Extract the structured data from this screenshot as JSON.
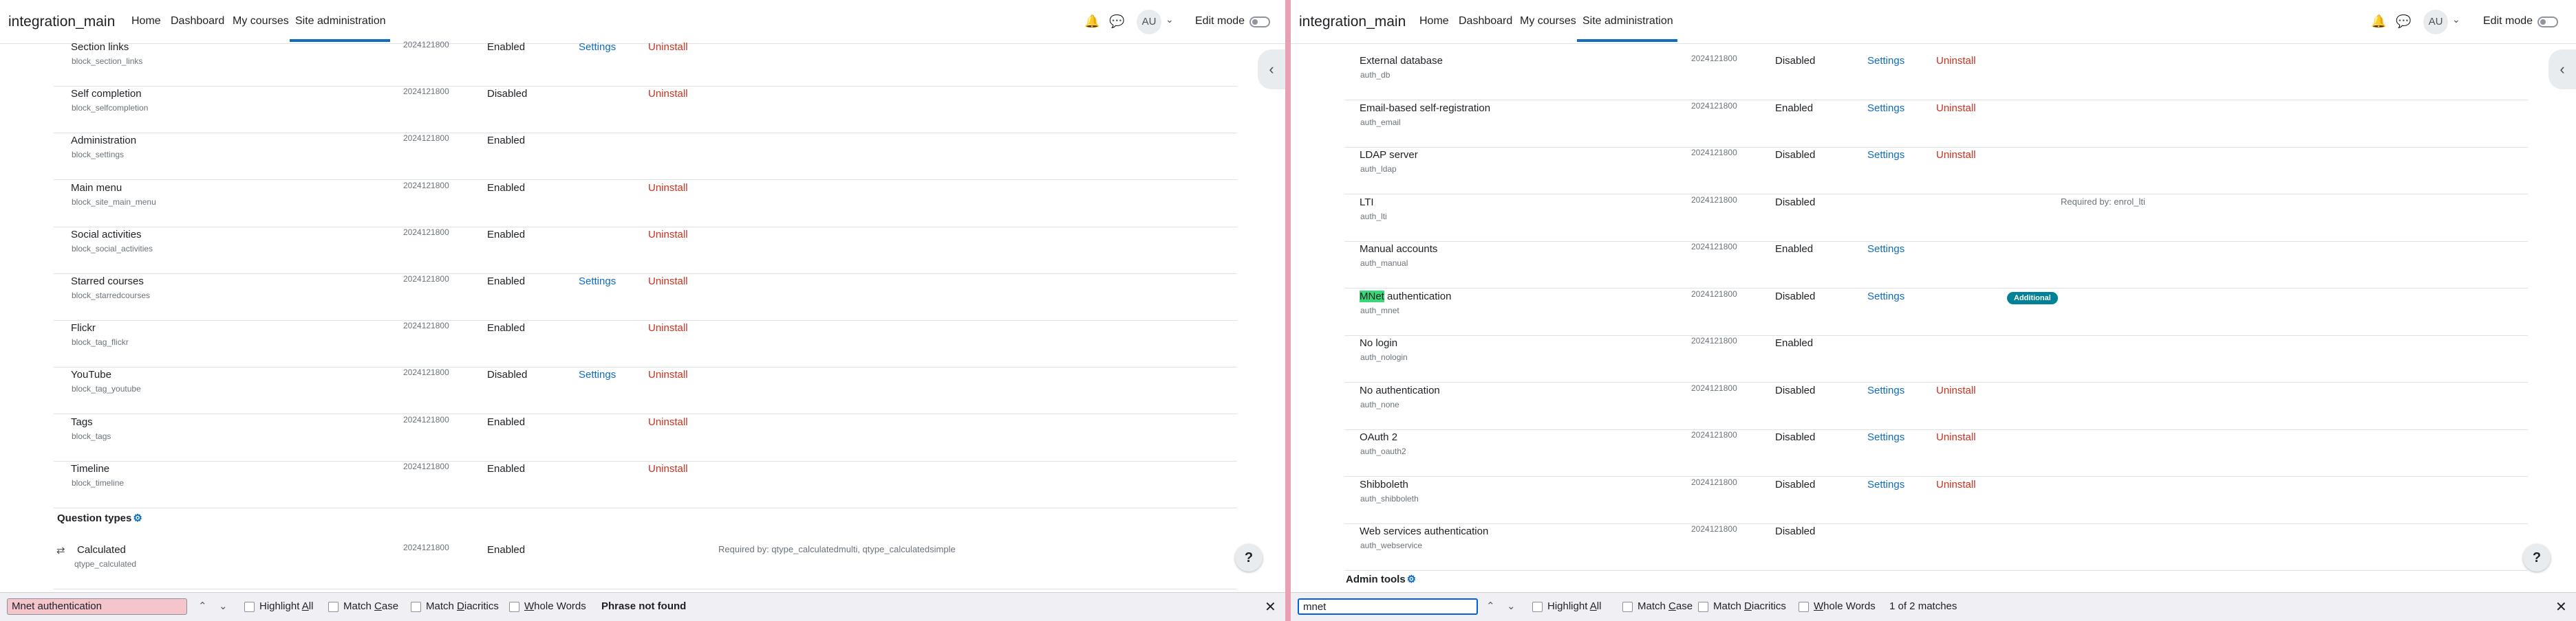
{
  "left": {
    "navbar": {
      "site_name": "integration_main",
      "items": [
        "Home",
        "Dashboard",
        "My courses",
        "Site administration"
      ],
      "avatar": "AU",
      "edit_mode": "Edit mode"
    },
    "rows": [
      {
        "name": "Section links",
        "id": "block_section_links",
        "version": "2024121800",
        "status": "Enabled",
        "settings": "Settings",
        "uninstall": "Uninstall"
      },
      {
        "name": "Self completion",
        "id": "block_selfcompletion",
        "version": "2024121800",
        "status": "Disabled",
        "settings": "",
        "uninstall": "Uninstall"
      },
      {
        "name": "Administration",
        "id": "block_settings",
        "version": "2024121800",
        "status": "Enabled",
        "settings": "",
        "uninstall": ""
      },
      {
        "name": "Main menu",
        "id": "block_site_main_menu",
        "version": "2024121800",
        "status": "Enabled",
        "settings": "",
        "uninstall": "Uninstall"
      },
      {
        "name": "Social activities",
        "id": "block_social_activities",
        "version": "2024121800",
        "status": "Enabled",
        "settings": "",
        "uninstall": "Uninstall"
      },
      {
        "name": "Starred courses",
        "id": "block_starredcourses",
        "version": "2024121800",
        "status": "Enabled",
        "settings": "Settings",
        "uninstall": "Uninstall"
      },
      {
        "name": "Flickr",
        "id": "block_tag_flickr",
        "version": "2024121800",
        "status": "Enabled",
        "settings": "",
        "uninstall": "Uninstall"
      },
      {
        "name": "YouTube",
        "id": "block_tag_youtube",
        "version": "2024121800",
        "status": "Disabled",
        "settings": "Settings",
        "uninstall": "Uninstall"
      },
      {
        "name": "Tags",
        "id": "block_tags",
        "version": "2024121800",
        "status": "Enabled",
        "settings": "",
        "uninstall": "Uninstall"
      },
      {
        "name": "Timeline",
        "id": "block_timeline",
        "version": "2024121800",
        "status": "Enabled",
        "settings": "",
        "uninstall": "Uninstall"
      }
    ],
    "section_title": "Question types",
    "calc_row": {
      "name": "Calculated",
      "id": "qtype_calculated",
      "version": "2024121800",
      "status": "Enabled",
      "required": "Required by: qtype_calculatedmulti, qtype_calculatedsimple"
    },
    "findbar": {
      "query": "Mnet authentication",
      "highlight_all": "Highlight All",
      "match_case": "Match Case",
      "match_diacritics": "Match Diacritics",
      "whole_words": "Whole Words",
      "status": "Phrase not found"
    }
  },
  "right": {
    "navbar": {
      "site_name": "integration_main",
      "items": [
        "Home",
        "Dashboard",
        "My courses",
        "Site administration"
      ],
      "avatar": "AU",
      "edit_mode": "Edit mode"
    },
    "rows": [
      {
        "name": "External database",
        "id": "auth_db",
        "version": "2024121800",
        "status": "Disabled",
        "settings": "Settings",
        "uninstall": "Uninstall",
        "required": ""
      },
      {
        "name": "Email-based self-registration",
        "id": "auth_email",
        "version": "2024121800",
        "status": "Enabled",
        "settings": "Settings",
        "uninstall": "Uninstall",
        "required": ""
      },
      {
        "name": "LDAP server",
        "id": "auth_ldap",
        "version": "2024121800",
        "status": "Disabled",
        "settings": "Settings",
        "uninstall": "Uninstall",
        "required": ""
      },
      {
        "name": "LTI",
        "id": "auth_lti",
        "version": "2024121800",
        "status": "Disabled",
        "settings": "",
        "uninstall": "",
        "required": "Required by: enrol_lti"
      },
      {
        "name": "Manual accounts",
        "id": "auth_manual",
        "version": "2024121800",
        "status": "Enabled",
        "settings": "Settings",
        "uninstall": "",
        "required": ""
      },
      {
        "name": "MNet authentication",
        "id": "auth_mnet",
        "version": "2024121800",
        "status": "Disabled",
        "settings": "Settings",
        "uninstall": "",
        "required": ""
      },
      {
        "name": "No login",
        "id": "auth_nologin",
        "version": "2024121800",
        "status": "Enabled",
        "settings": "",
        "uninstall": "",
        "required": ""
      },
      {
        "name": "No authentication",
        "id": "auth_none",
        "version": "2024121800",
        "status": "Disabled",
        "settings": "Settings",
        "uninstall": "Uninstall",
        "required": ""
      },
      {
        "name": "OAuth 2",
        "id": "auth_oauth2",
        "version": "2024121800",
        "status": "Disabled",
        "settings": "Settings",
        "uninstall": "Uninstall",
        "required": ""
      },
      {
        "name": "Shibboleth",
        "id": "auth_shibboleth",
        "version": "2024121800",
        "status": "Disabled",
        "settings": "Settings",
        "uninstall": "Uninstall",
        "required": ""
      },
      {
        "name": "Web services authentication",
        "id": "auth_webservice",
        "version": "2024121800",
        "status": "Disabled",
        "settings": "",
        "uninstall": "",
        "required": ""
      }
    ],
    "mnet_highlight": "MNet",
    "mnet_rest": " authentication",
    "badge": "Additional",
    "section_title": "Admin tools",
    "findbar": {
      "query": "mnet",
      "highlight_all": "Highlight All",
      "match_case": "Match Case",
      "match_diacritics": "Match Diacritics",
      "whole_words": "Whole Words",
      "status": "1 of 2 matches"
    }
  },
  "colors": {
    "link": "#0f6cbf",
    "uninstall": "#ca3120",
    "badge": "#008196",
    "highlight": "#38d878",
    "divider": "#e8a1b4"
  }
}
